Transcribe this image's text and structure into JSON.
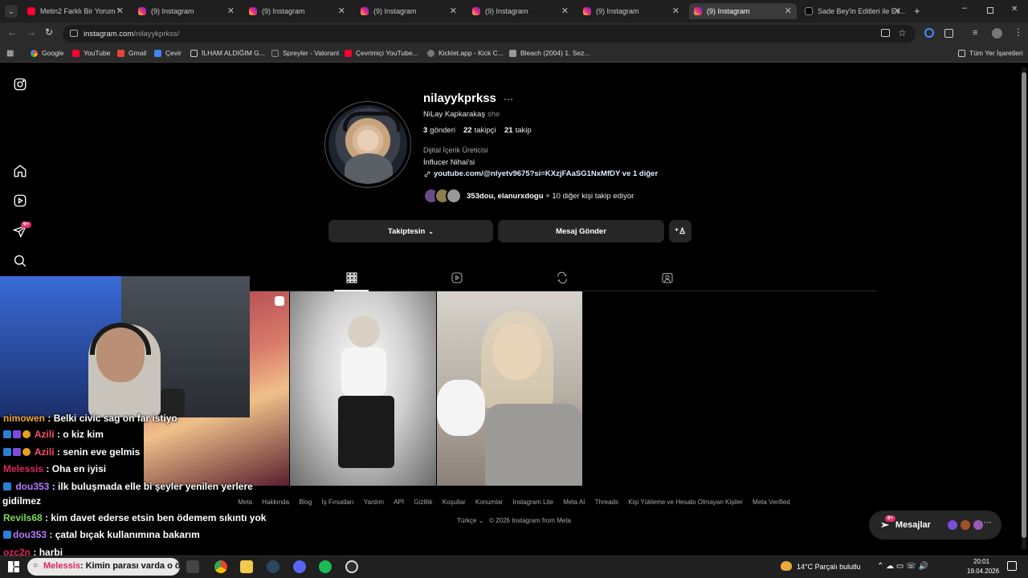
{
  "browser": {
    "tabs": [
      {
        "label": "Metin2 Farklı Bir Yorum \"",
        "icon": "youtube-icon"
      },
      {
        "label": "(9) Instagram",
        "icon": "instagram-icon"
      },
      {
        "label": "(9) Instagram",
        "icon": "instagram-icon"
      },
      {
        "label": "(9) Instagram",
        "icon": "instagram-icon"
      },
      {
        "label": "(9) Instagram",
        "icon": "instagram-icon"
      },
      {
        "label": "(9) Instagram",
        "icon": "instagram-icon"
      },
      {
        "label": "(9) Instagram",
        "icon": "instagram-icon",
        "active": true
      },
      {
        "label": "Sade Bey'in Editleri ile Ev...",
        "icon": "tiktok-icon"
      }
    ],
    "url_host": "instagram.com",
    "url_path": "/nilayykprkss/",
    "bookmarks": [
      "Google",
      "YouTube",
      "Gmail",
      "Çevir",
      "İLHAM ALDIĞIM G...",
      "Spreyler - Valorant",
      "Çevrimiçi YouTube...",
      "Kicklet.app - Kick C...",
      "Bleach (2004) 1. Sez..."
    ],
    "all_bookmarks": "Tüm Yer İşaretleri"
  },
  "sidebar": {
    "notification_badge": "9+"
  },
  "profile": {
    "username": "nilayykprkss",
    "full_name": "NiLay Kapkarakaş",
    "pronoun": "she",
    "posts_count": "3",
    "posts_label": "gönderi",
    "followers_count": "22",
    "followers_label": "takipçi",
    "following_count": "21",
    "following_label": "takip",
    "category": "Dijital İçerik Üreticisi",
    "bio": "İnflucer Nihai'si",
    "link": "youtube.com/@nlyetv9675?si=KXzjFAaSG1NxMfDY ve 1 diğer",
    "followed_by_names": "353dou, elanurxdogu",
    "followed_by_rest": "+ 10 diğer kişi takip ediyor"
  },
  "actions": {
    "following_button": "Takiptesin",
    "message_button": "Mesaj Gönder"
  },
  "footer": {
    "links": [
      "Meta",
      "Hakkında",
      "Blog",
      "İş Fırsatları",
      "Yardım",
      "API",
      "Gizlilik",
      "Koşullar",
      "Konumlar",
      "Instagram Lite",
      "Meta AI",
      "Threads",
      "Kişi Yükleme ve Hesabı Olmayan Kişiler",
      "Meta Verified"
    ],
    "language": "Türkçe",
    "copyright": "© 2026 Instagram from Meta"
  },
  "messages": {
    "label": "Mesajlar",
    "badge": "9+"
  },
  "chat": [
    {
      "user": "nimowen",
      "text": ": Belki civic sag on far istiyo",
      "color": "#f2a93b"
    },
    {
      "user": "Azili",
      "text": ": o kiz kim",
      "color": "#ff4d6d"
    },
    {
      "user": "Azili",
      "text": ": senin eve gelmis",
      "color": "#ff4d6d"
    },
    {
      "user": "Melessis",
      "text": ": Oha en iyisi",
      "color": "#e0245e"
    },
    {
      "user": "dou353",
      "text": ": ilk buluşmada elle bi şeyler yenilen yerlere",
      "color": "#b57cff"
    },
    {
      "user": "",
      "text": "gidilmez",
      "color": "#ffffff"
    },
    {
      "user": "Revils68",
      "text": ": kim davet ederse etsin ben ödemem sıkıntı yok",
      "color": "#7ed957"
    },
    {
      "user": "dou353",
      "text": ": çatal bıçak kullanımına bakarım",
      "color": "#b57cff"
    },
    {
      "user": "ozc2n",
      "text": ": harbi",
      "color": "#e0245e"
    },
    {
      "user": "Melessis",
      "text": ": Kimin parası varda o ödesin bence",
      "color": "#e0245e"
    }
  ],
  "taskbar": {
    "weather": "14°C  Parçalı bulutlu",
    "time": "20:01",
    "date": "19.04.2026"
  },
  "colors": {
    "background": "#000000",
    "button": "#262626",
    "secondary_text": "#a8a8a8"
  }
}
